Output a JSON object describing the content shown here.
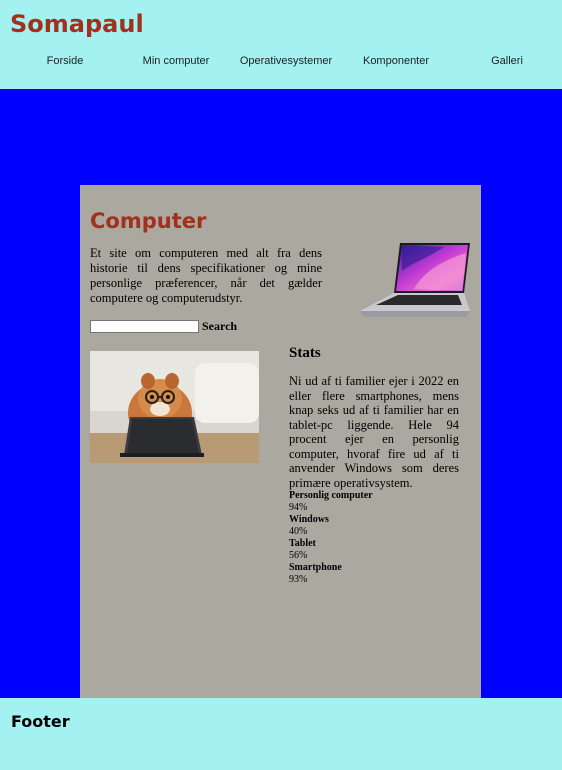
{
  "header": {
    "site_title": "Somapaul",
    "nav": [
      "Forside",
      "Min computer",
      "Operativesystemer",
      "Komponenter",
      "Galleri"
    ]
  },
  "card": {
    "title": "Computer",
    "intro": "Et site om computeren med alt fra dens historie til dens specifikationer og mine personlige præferencer, når det gælder computere og computerudstyr.",
    "search": {
      "value": "",
      "button_label": "Search"
    }
  },
  "stats": {
    "heading": "Stats",
    "paragraph": "Ni ud af ti familier ejer i 2022 en eller flere smartphones, mens knap seks ud af ti familier har en tablet-pc liggende. Hele 94 procent ejer en personlig computer, hvoraf fire ud af ti anvender Windows som deres primære operativsystem.",
    "items": [
      {
        "label": "Personlig computer",
        "value": "94%"
      },
      {
        "label": "Windows",
        "value": "40%"
      },
      {
        "label": "Tablet",
        "value": "56%"
      },
      {
        "label": "Smartphone",
        "value": "93%"
      }
    ]
  },
  "footer": {
    "title": "Footer"
  },
  "colors": {
    "header_bg": "#a3f1f1",
    "main_bg": "#0000ff",
    "card_bg": "#aba8a0",
    "title_red": "#a2301c"
  }
}
